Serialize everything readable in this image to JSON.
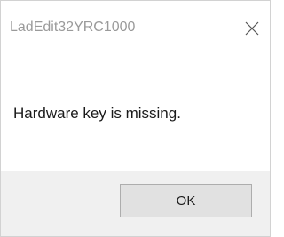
{
  "window": {
    "title": "LadEdit32YRC1000",
    "close_icon": "close-icon"
  },
  "message": {
    "text": "Hardware key is missing."
  },
  "buttons": {
    "ok_label": "OK"
  },
  "colors": {
    "title_text": "#9a9a9a",
    "body_text": "#1a1a1a",
    "footer_bg": "#f0f0f0",
    "button_bg": "#e1e1e1",
    "button_border": "#adadad"
  }
}
